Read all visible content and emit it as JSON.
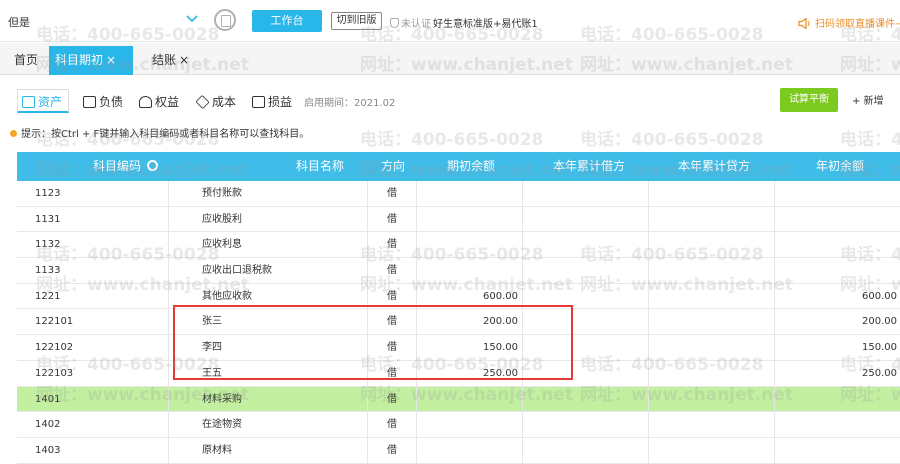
{
  "topbar": {
    "company": "但是",
    "workbench_label": "工作台",
    "old_version_label": "切到旧版",
    "cert_status": "未认证",
    "edition": "好生意标准版+易代账1",
    "promo": "扫码领取直播课件→"
  },
  "tabs": [
    {
      "label": "首页"
    },
    {
      "label": "科目期初",
      "close": "×"
    },
    {
      "label": "结账",
      "close": "×"
    }
  ],
  "subtabs": [
    {
      "label": "资产"
    },
    {
      "label": "负债"
    },
    {
      "label": "权益"
    },
    {
      "label": "成本"
    },
    {
      "label": "损益"
    }
  ],
  "start_period": "启用期间：2021.02",
  "trial_balance_label": "试算平衡",
  "add_label": "+ 新增",
  "hint": "提示：按Ctrl + F键并输入科目编码或者科目名称可以查找科目。",
  "columns": [
    "科目编码",
    "科目名称",
    "方向",
    "期初余额",
    "本年累计借方",
    "本年累计贷方",
    "年初余额"
  ],
  "rows": [
    {
      "code": "1123",
      "name": "预付账款",
      "dir": "借",
      "opening": "",
      "debit": "",
      "credit": "",
      "year_open": ""
    },
    {
      "code": "1131",
      "name": "应收股利",
      "dir": "借",
      "opening": "",
      "debit": "",
      "credit": "",
      "year_open": ""
    },
    {
      "code": "1132",
      "name": "应收利息",
      "dir": "借",
      "opening": "",
      "debit": "",
      "credit": "",
      "year_open": ""
    },
    {
      "code": "1133",
      "name": "应收出口退税款",
      "dir": "借",
      "opening": "",
      "debit": "",
      "credit": "",
      "year_open": ""
    },
    {
      "code": "1221",
      "name": "其他应收款",
      "dir": "借",
      "opening": "600.00",
      "debit": "",
      "credit": "",
      "year_open": "600.00"
    },
    {
      "code": "122101",
      "name": "张三",
      "dir": "借",
      "opening": "200.00",
      "debit": "",
      "credit": "",
      "year_open": "200.00"
    },
    {
      "code": "122102",
      "name": "李四",
      "dir": "借",
      "opening": "150.00",
      "debit": "",
      "credit": "",
      "year_open": "150.00"
    },
    {
      "code": "122103",
      "name": "王五",
      "dir": "借",
      "opening": "250.00",
      "debit": "",
      "credit": "",
      "year_open": "250.00"
    },
    {
      "code": "1401",
      "name": "材料采购",
      "dir": "借",
      "opening": "",
      "debit": "",
      "credit": "",
      "year_open": ""
    },
    {
      "code": "1402",
      "name": "在途物资",
      "dir": "借",
      "opening": "",
      "debit": "",
      "credit": "",
      "year_open": ""
    },
    {
      "code": "1403",
      "name": "原材料",
      "dir": "借",
      "opening": "",
      "debit": "",
      "credit": "",
      "year_open": ""
    }
  ],
  "watermark_phone": "电话：400-665-0028",
  "watermark_url": "网址：www.chanjet.net",
  "colors": {
    "accent": "#29b6e8",
    "header": "#3fbde8",
    "green_button": "#7cc91f",
    "highlight_row": "#c2f0a0",
    "annotation": "#e53935",
    "promo": "#f08c1e"
  }
}
